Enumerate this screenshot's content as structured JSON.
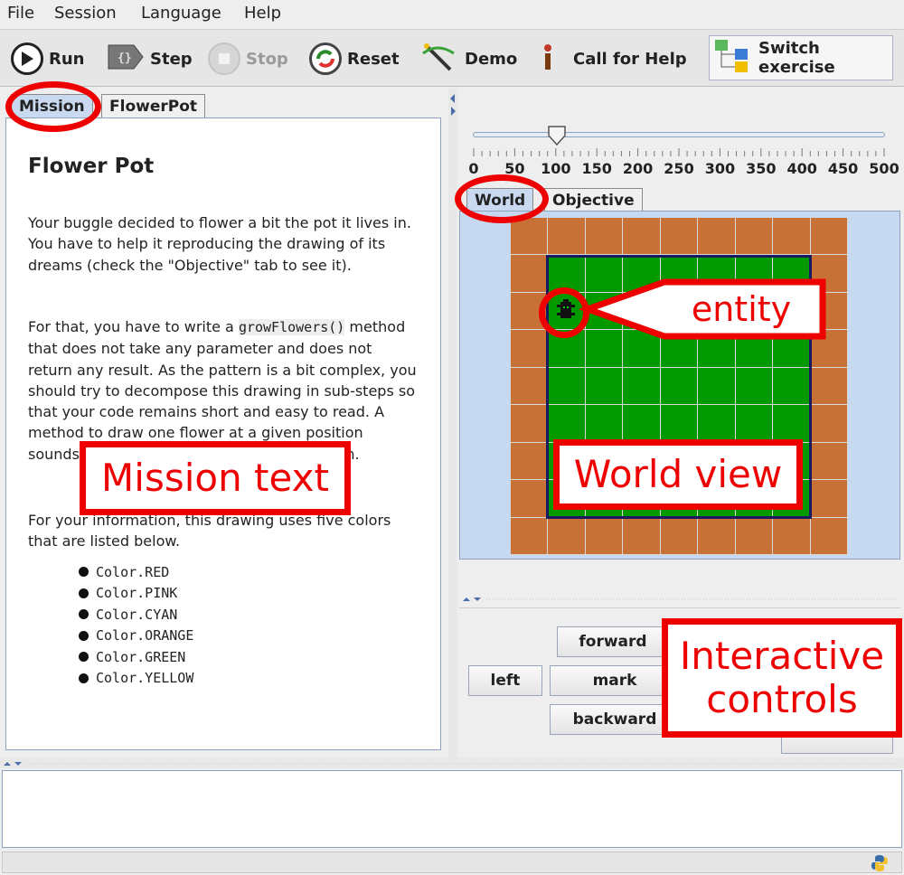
{
  "menu": [
    "File",
    "Session",
    "Language",
    "Help"
  ],
  "toolbar": {
    "run": "Run",
    "step": "Step",
    "stop": "Stop",
    "reset": "Reset",
    "demo": "Demo",
    "call_for_help": "Call for Help",
    "switch_exercise": "Switch exercise"
  },
  "left_tabs": [
    "Mission",
    "FlowerPot"
  ],
  "mission": {
    "title": "Flower Pot",
    "paragraph1": "Your buggle decided to flower a bit the pot it lives in. You have to help it reproducing the drawing of its dreams (check the \"Objective\" tab to see it).",
    "paragraph2_before": "For that, you have to write a ",
    "paragraph2_code": "growFlowers()",
    "paragraph2_after": " method that does not take any parameter and does not return any result. As the pattern is a bit complex, you should try to decompose this drawing in sub-steps so that your code remains short and easy to read. A method to draw one flower at a given position sounds like a good idea, for example, though.",
    "paragraph3": "For your information, this drawing uses five colors that are listed below.",
    "colors": [
      "Color.RED",
      "Color.PINK",
      "Color.CYAN",
      "Color.ORANGE",
      "Color.GREEN",
      "Color.YELLOW"
    ]
  },
  "speed_slider": {
    "ticks": [
      "0",
      "50",
      "100",
      "150",
      "200",
      "250",
      "300",
      "350",
      "400",
      "450",
      "500"
    ],
    "value": 100
  },
  "world_tabs": [
    "World",
    "Objective"
  ],
  "controls": {
    "forward": "forward",
    "left": "left",
    "mark": "mark",
    "backward": "backward"
  },
  "annotations": {
    "entity": "entity",
    "mission_text": "Mission text",
    "world_view": "World view",
    "interactive_controls": "Interactive controls"
  },
  "colors": {
    "annotation_red": "#ee0000",
    "ground_orange": "#c87137",
    "ground_green": "#009900",
    "active_tab": "#c9daf0"
  }
}
